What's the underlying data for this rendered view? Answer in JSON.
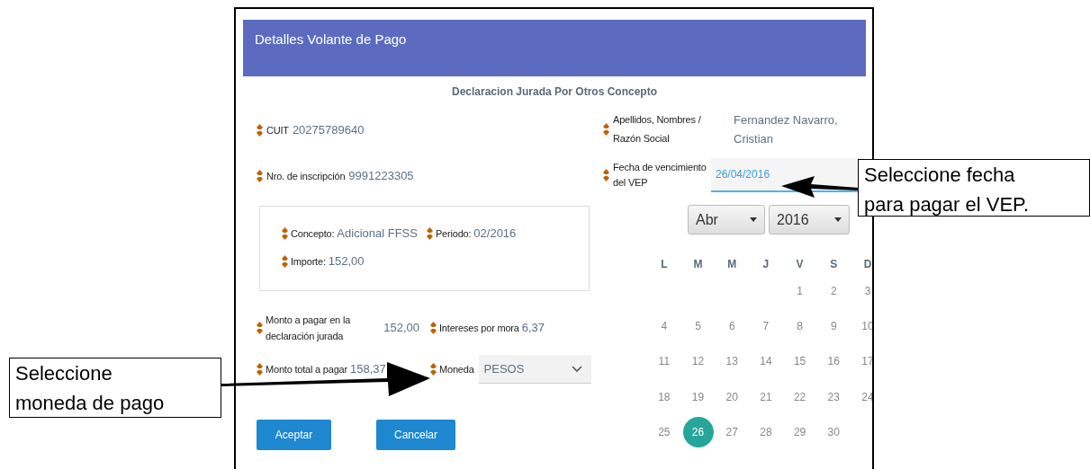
{
  "dialog": {
    "title": "Detalles Volante de Pago",
    "subtitle": "Declaracion Jurada Por Otros Concepto"
  },
  "left_fields": [
    {
      "label": "CUIT",
      "value": "20275789640"
    },
    {
      "label": "Nro. de inscripción",
      "value": "9991223305"
    }
  ],
  "concept_box": {
    "rows": [
      [
        {
          "label": "Concepto:",
          "value": "Adicional FFSS"
        },
        {
          "label": "Periodo:",
          "value": "02/2016"
        }
      ],
      [
        {
          "label": "Importe:",
          "value": "152,00"
        }
      ]
    ]
  },
  "amounts": [
    {
      "label": "Monto a pagar en la declaración jurada",
      "value": "152,00"
    },
    {
      "label": "Intereses por mora",
      "value": "6,37"
    }
  ],
  "total": {
    "label": "Monto total a pagar",
    "value": "158,37"
  },
  "currency": {
    "label": "Moneda",
    "value": "PESOS"
  },
  "buttons": [
    "Aceptar",
    "Cancelar"
  ],
  "right_fields": [
    {
      "kind": "text",
      "label": "Apellidos, Nombres / Razón Social",
      "value": "Fernandez Navarro, Cristian"
    },
    {
      "kind": "input",
      "label": "Fecha de vencimiento del VEP",
      "value": "26/04/2016"
    }
  ],
  "calendar": {
    "month": "Abr",
    "year": "2016",
    "weekdays": [
      "L",
      "M",
      "M",
      "J",
      "V",
      "S",
      "D"
    ],
    "weeks": [
      [
        {
          "day": "1",
          "selected": false
        },
        {
          "day": "2",
          "selected": false
        },
        {
          "day": "3",
          "selected": false
        }
      ],
      [
        {
          "day": "4",
          "selected": false
        },
        {
          "day": "5",
          "selected": false
        },
        {
          "day": "6",
          "selected": false
        },
        {
          "day": "7",
          "selected": false
        },
        {
          "day": "8",
          "selected": false
        },
        {
          "day": "9",
          "selected": false
        },
        {
          "day": "10",
          "selected": false
        }
      ],
      [
        {
          "day": "11",
          "selected": false
        },
        {
          "day": "12",
          "selected": false
        },
        {
          "day": "13",
          "selected": false
        },
        {
          "day": "14",
          "selected": false
        },
        {
          "day": "15",
          "selected": false
        },
        {
          "day": "16",
          "selected": false
        },
        {
          "day": "17",
          "selected": false
        }
      ],
      [
        {
          "day": "18",
          "selected": false
        },
        {
          "day": "19",
          "selected": false
        },
        {
          "day": "20",
          "selected": false
        },
        {
          "day": "21",
          "selected": false
        },
        {
          "day": "22",
          "selected": false
        },
        {
          "day": "23",
          "selected": false
        },
        {
          "day": "24",
          "selected": false
        }
      ],
      [
        {
          "day": "25",
          "selected": false
        },
        {
          "day": "26",
          "selected": true
        },
        {
          "day": "27",
          "selected": false
        },
        {
          "day": "28",
          "selected": false
        },
        {
          "day": "29",
          "selected": false
        },
        {
          "day": "30",
          "selected": false
        }
      ]
    ]
  },
  "callouts": [
    {
      "text": "Seleccione fecha\npara pagar el VEP."
    },
    {
      "text": "Seleccione\nmoneda de pago"
    }
  ]
}
